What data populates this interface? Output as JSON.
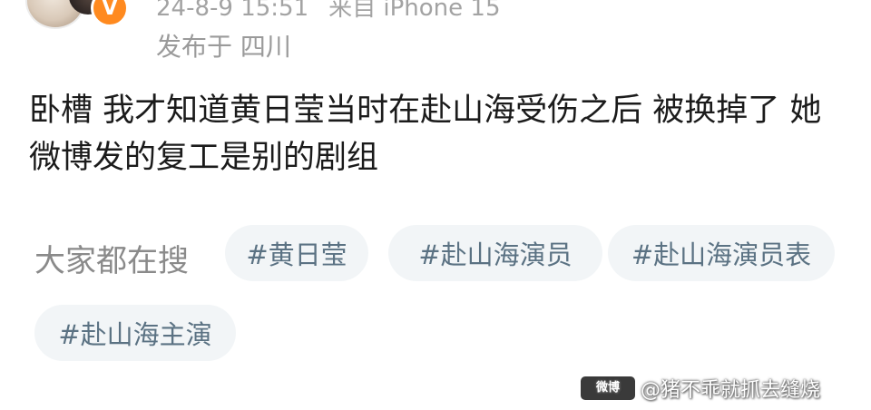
{
  "post": {
    "timestamp": "24-8-9 15:51",
    "source": "来自 iPhone 15",
    "location": "发布于 四川",
    "verified_badge": "V",
    "content": "卧槽 我才知道黄日莹当时在赴山海受伤之后 被换掉了 她微博发的复工是别的剧组"
  },
  "trending": {
    "label": "大家都在搜",
    "tags": [
      "#黄日莹",
      "#赴山海演员",
      "#赴山海演员表",
      "#赴山海主演"
    ]
  },
  "watermark": {
    "logo": "微博",
    "text": "@猪不乖就抓去缝烧"
  }
}
